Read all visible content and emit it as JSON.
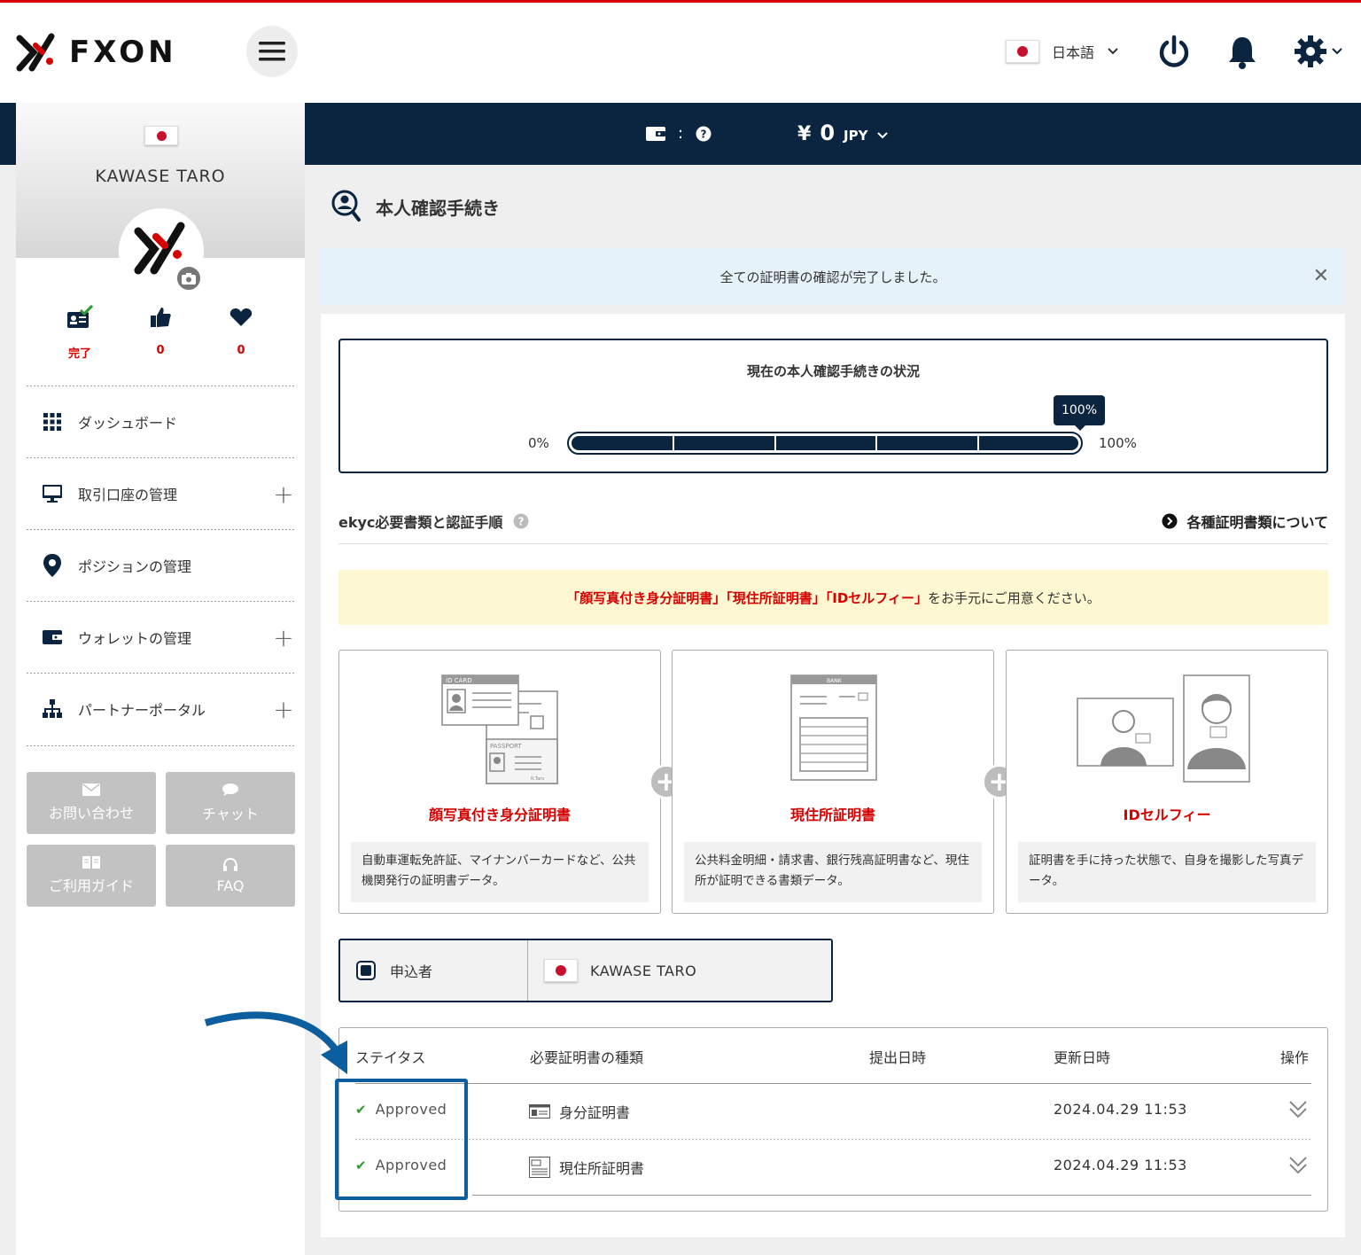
{
  "header": {
    "logo_text": "FXON",
    "language": "日本語"
  },
  "wallet": {
    "separator": ":",
    "currency_symbol": "¥",
    "amount": "0",
    "currency": "JPY"
  },
  "sidebar": {
    "username": "KAWASE TARO",
    "stats": [
      {
        "icon": "id-card-check-icon",
        "value": "完了"
      },
      {
        "icon": "thumbs-up-icon",
        "value": "0"
      },
      {
        "icon": "heart-icon",
        "value": "0"
      }
    ],
    "menu": [
      {
        "label": "ダッシュボード",
        "expandable": false
      },
      {
        "label": "取引口座の管理",
        "expandable": true
      },
      {
        "label": "ポジションの管理",
        "expandable": false
      },
      {
        "label": "ウォレットの管理",
        "expandable": true
      },
      {
        "label": "パートナーポータル",
        "expandable": true
      }
    ],
    "buttons": [
      {
        "label": "お問い合わせ",
        "icon": "mail-icon"
      },
      {
        "label": "チャット",
        "icon": "chat-icon"
      },
      {
        "label": "ご利用ガイド",
        "icon": "book-icon"
      },
      {
        "label": "FAQ",
        "icon": "headset-icon"
      }
    ]
  },
  "main": {
    "title": "本人確認手続き",
    "alert": "全ての証明書の確認が完了しました。",
    "status": {
      "title": "現在の本人確認手続きの状況",
      "min_label": "0%",
      "max_label": "100%",
      "progress_label": "100%",
      "progress": 100
    },
    "ekyc": {
      "title": "ekyc必要書類と認証手順",
      "link": "各種証明書類について"
    },
    "notice": {
      "highlight": "「顔写真付き身分証明書」「現住所証明書」「IDセルフィー」",
      "rest": "をお手元にご用意ください。"
    },
    "cards": [
      {
        "title": "顔写真付き身分証明書",
        "desc": "自動車運転免許証、マイナンバーカードなど、公共機関発行の証明書データ。",
        "art": [
          "ID CARD",
          "PASSPORT",
          "R.Taro"
        ]
      },
      {
        "title": "現住所証明書",
        "desc": "公共料金明細・請求書、銀行残高証明書など、現住所が証明できる書類データ。",
        "art": [
          "BANK"
        ]
      },
      {
        "title": "IDセルフィー",
        "desc": "証明書を手に持った状態で、自身を撮影した写真データ。",
        "art": []
      }
    ],
    "applicant": {
      "label": "申込者",
      "name": "KAWASE TARO"
    },
    "table": {
      "headers": [
        "ステイタス",
        "必要証明書の種類",
        "提出日時",
        "更新日時",
        "操作"
      ],
      "rows": [
        {
          "status": "Approved",
          "type": "身分証明書",
          "submitted": "",
          "updated": "2024.04.29 11:53"
        },
        {
          "status": "Approved",
          "type": "現住所証明書",
          "submitted": "",
          "updated": "2024.04.29 11:53"
        }
      ]
    }
  }
}
